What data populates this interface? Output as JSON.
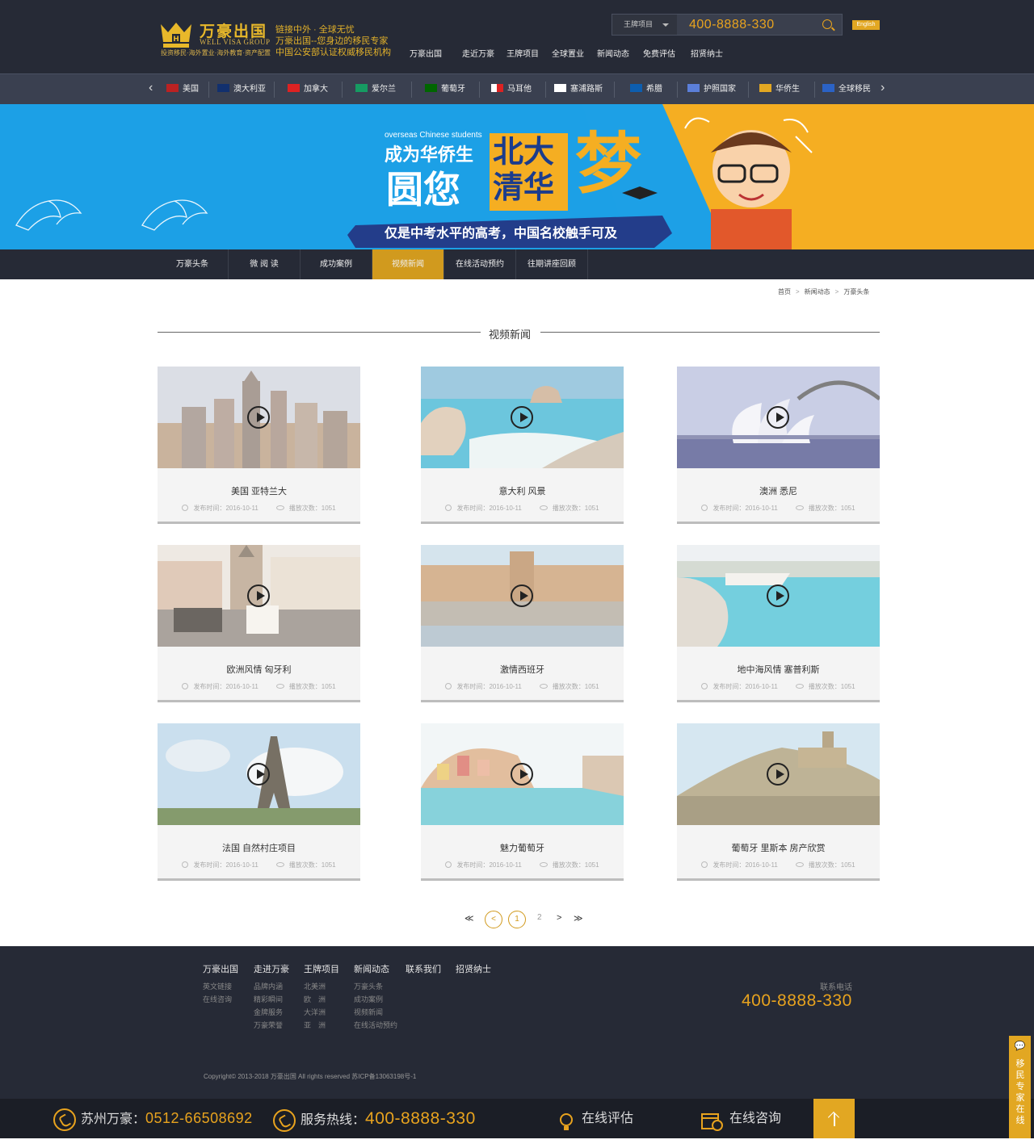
{
  "header": {
    "logo_name": "万豪出国",
    "logo_en": "WELL VISA GROUP",
    "logo_sub": "投资移民·海外置业·海外教育·资产配置",
    "slogan": [
      "链接中外 · 全球无忧",
      "万豪出国--您身边的移民专家",
      "中国公安部认证权威移民机构"
    ],
    "search_select": "王牌项目",
    "search_phone": "400-8888-330",
    "english": "English",
    "nav": [
      "万豪出国",
      "走近万豪",
      "王牌项目",
      "全球置业",
      "新闻动态",
      "免费评估",
      "招贤纳士"
    ]
  },
  "countries": [
    {
      "label": "美国",
      "flag": "us"
    },
    {
      "label": "澳大利亚",
      "flag": "au"
    },
    {
      "label": "加拿大",
      "flag": "ca"
    },
    {
      "label": "爱尔兰",
      "flag": "ie"
    },
    {
      "label": "葡萄牙",
      "flag": "pt"
    },
    {
      "label": "马耳他",
      "flag": "mt"
    },
    {
      "label": "塞浦路斯",
      "flag": "cy"
    },
    {
      "label": "希腊",
      "flag": "gr"
    },
    {
      "label": "护照国家",
      "flag": "passport"
    },
    {
      "label": "华侨生",
      "flag": "student"
    },
    {
      "label": "全球移民",
      "flag": "globe"
    }
  ],
  "banner": {
    "en": "overseas Chinese students",
    "line1": "成为华侨生",
    "line2": "圆您",
    "box1": "北大",
    "box2": "清华",
    "dream": "梦",
    "ribbon": "仅是中考水平的高考，中国名校触手可及"
  },
  "subnav": {
    "tabs": [
      "万豪头条",
      "微 阅 读",
      "成功案例",
      "视频新闻",
      "在线活动预约",
      "往期讲座回顾"
    ],
    "active": 3
  },
  "breadcrumb": [
    "首页",
    "新闻动态",
    "万豪头条"
  ],
  "section_title": "视频新闻",
  "meta_labels": {
    "date": "发布时间：",
    "views": "播放次数："
  },
  "videos": [
    {
      "title": "美国 亚特兰大",
      "date": "2016-10-11",
      "views": "1051",
      "scene": "city"
    },
    {
      "title": "意大利 风景",
      "date": "2016-10-11",
      "views": "1051",
      "scene": "coast"
    },
    {
      "title": "澳洲 悉尼",
      "date": "2016-10-11",
      "views": "1051",
      "scene": "sydney"
    },
    {
      "title": "欧洲风情 匈牙利",
      "date": "2016-10-11",
      "views": "1051",
      "scene": "square"
    },
    {
      "title": "激情西班牙",
      "date": "2016-10-11",
      "views": "1051",
      "scene": "palace"
    },
    {
      "title": "地中海风情 塞普利斯",
      "date": "2016-10-11",
      "views": "1051",
      "scene": "bay"
    },
    {
      "title": "法国 自然村庄项目",
      "date": "2016-10-11",
      "views": "1051",
      "scene": "tower"
    },
    {
      "title": "魅力葡萄牙",
      "date": "2016-10-11",
      "views": "1051",
      "scene": "village"
    },
    {
      "title": "葡萄牙 里斯本 房产欣赏",
      "date": "2016-10-11",
      "views": "1051",
      "scene": "hill"
    }
  ],
  "pager": {
    "first": "≪",
    "prev": "<",
    "current": "1",
    "next_page": "2",
    "next": ">",
    "last": "≫"
  },
  "footer": {
    "cols": [
      {
        "h": "万豪出国",
        "links": [
          "英文链接",
          "在线咨询"
        ]
      },
      {
        "h": "走进万豪",
        "links": [
          "品牌内涵",
          "精彩瞬间",
          "金牌服务",
          "万豪荣誉"
        ]
      },
      {
        "h": "王牌项目",
        "links": [
          "北美洲",
          "欧　洲",
          "大洋洲",
          "亚　洲"
        ]
      },
      {
        "h": "新闻动态",
        "links": [
          "万豪头条",
          "成功案例",
          "视频新闻",
          "在线活动预约"
        ]
      },
      {
        "h": "联系我们",
        "links": []
      },
      {
        "h": "招贤纳士",
        "links": []
      }
    ],
    "phone_label": "联系电话",
    "phone": "400-8888-330",
    "copyright": "Copyright© 2013-2018  万豪出国    All rights reserved    苏ICP备13063198号-1"
  },
  "bottombar": {
    "suzhou_label": "苏州万豪：",
    "suzhou_phone": "0512-66508692",
    "hotline_label": "服务热线：",
    "hotline": "400-8888-330",
    "assess": "在线评估",
    "consult": "在线咨询"
  },
  "side": {
    "text": "移民专家在线"
  },
  "colors": {
    "accent": "#e2a722",
    "dark": "#262a36",
    "phone": "#e8a31e"
  }
}
